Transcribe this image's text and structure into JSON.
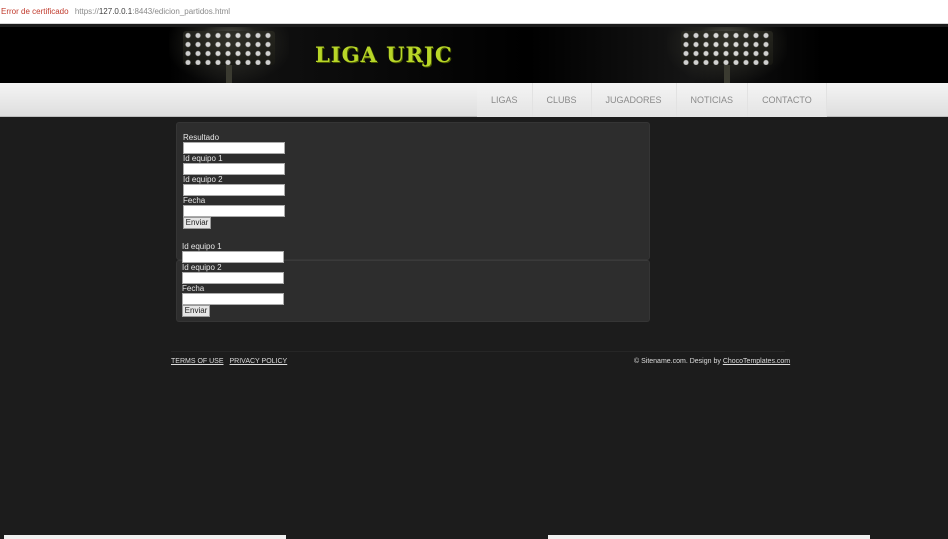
{
  "browser": {
    "cert_error": "Error de certificado",
    "url_prefix": "https://",
    "url_host": "127.0.0.1",
    "url_rest": ":8443/edicion_partidos.html"
  },
  "header": {
    "logo_text": "LIGA URJC"
  },
  "nav": {
    "items": [
      "LIGAS",
      "CLUBS",
      "JUGADORES",
      "NOTICIAS",
      "CONTACTO"
    ]
  },
  "form1": {
    "label_resultado": "Resultado",
    "label_equipo1": "Id equipo 1",
    "label_equipo2": "Id equipo 2",
    "label_fecha": "Fecha",
    "submit_label": "Enviar"
  },
  "form2": {
    "label_equipo1": "Id equipo 1",
    "label_equipo2": "Id equipo 2",
    "label_fecha": "Fecha",
    "submit_label": "Enviar"
  },
  "footer": {
    "terms": "TERMS OF USE",
    "privacy": "PRIVACY POLICY",
    "credit_prefix": "© Sitename.com. Design by ",
    "credit_link": "ChocoTemplates.com"
  },
  "colors": {
    "accent": "#b8d628",
    "background": "#1c1c1c",
    "panel": "#2d2d2d",
    "cert_error": "#c0392b"
  }
}
